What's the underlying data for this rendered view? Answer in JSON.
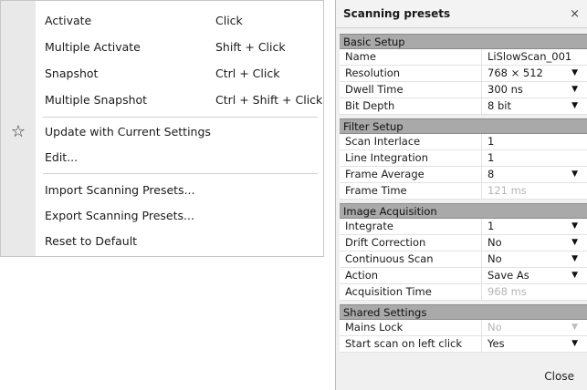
{
  "menu": {
    "items": [
      {
        "label": "Activate",
        "shortcut": "Click"
      },
      {
        "label": "Multiple Activate",
        "shortcut": "Shift + Click"
      },
      {
        "label": "Snapshot",
        "shortcut": "Ctrl + Click"
      },
      {
        "label": "Multiple Snapshot",
        "shortcut": "Ctrl + Shift + Click"
      },
      {
        "label": "Update with Current Settings",
        "icon": "star-icon"
      },
      {
        "label": "Edit..."
      },
      {
        "label": "Import Scanning Presets..."
      },
      {
        "label": "Export Scanning Presets..."
      },
      {
        "label": "Reset to Default"
      }
    ]
  },
  "panel": {
    "title": "Scanning presets",
    "close_glyph": "×",
    "footer_close": "Close",
    "sections": [
      {
        "name": "Basic Setup",
        "rows": [
          {
            "key": "Name",
            "value": "LiSlowScan_001"
          },
          {
            "key": "Resolution",
            "value": "768 × 512",
            "dropdown": true
          },
          {
            "key": "Dwell Time",
            "value": "300 ns",
            "dropdown": true
          },
          {
            "key": "Bit Depth",
            "value": "8 bit",
            "dropdown": true
          }
        ]
      },
      {
        "name": "Filter Setup",
        "rows": [
          {
            "key": "Scan Interlace",
            "value": "1"
          },
          {
            "key": "Line Integration",
            "value": "1"
          },
          {
            "key": "Frame Average",
            "value": "8",
            "dropdown": true
          },
          {
            "key": "Frame Time",
            "value": "121 ms",
            "muted": true
          }
        ]
      },
      {
        "name": "Image Acquisition",
        "rows": [
          {
            "key": "Integrate",
            "value": "1",
            "dropdown": true
          },
          {
            "key": "Drift Correction",
            "value": "No",
            "dropdown": true
          },
          {
            "key": "Continuous Scan",
            "value": "No",
            "dropdown": true
          },
          {
            "key": "Action",
            "value": "Save As",
            "dropdown": true
          },
          {
            "key": "Acquisition Time",
            "value": "968 ms",
            "muted": true
          }
        ]
      },
      {
        "name": "Shared Settings",
        "rows": [
          {
            "key": "Mains Lock",
            "value": "No",
            "dropdown": true,
            "muted": true
          },
          {
            "key": "Start scan on left click",
            "value": "Yes",
            "dropdown": true
          }
        ]
      }
    ]
  }
}
